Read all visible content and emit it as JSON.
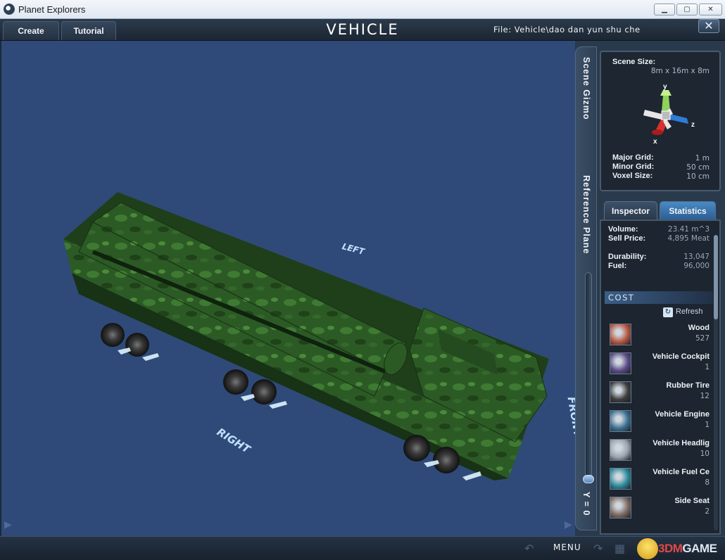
{
  "window": {
    "title": "Planet Explorers",
    "min_glyph": "▁",
    "max_glyph": "▢",
    "close_glyph": "✕"
  },
  "topbar": {
    "tabs": [
      "Create",
      "Tutorial"
    ],
    "title": "VEHICLE",
    "file_label": "File:  Vehicle\\dao dan yun shu che",
    "close_glyph": "✕"
  },
  "viewport": {
    "labels": {
      "left": "LEFT",
      "right": "RIGHT",
      "front": "FRONT"
    },
    "nav_left": "▶",
    "nav_right": "▶"
  },
  "side": {
    "tab_gizmo": "Scene Gizmo",
    "tab_reference": "Reference Plane",
    "y_label": "Y = 0",
    "gizmo": {
      "scene_size_label": "Scene Size:",
      "scene_size_value": "8m x 16m x 8m",
      "axis_y": "y",
      "axis_x": "x",
      "axis_z": "z",
      "major_grid_label": "Major Grid:",
      "major_grid_value": "1 m",
      "minor_grid_label": "Minor Grid:",
      "minor_grid_value": "50 cm",
      "voxel_size_label": "Voxel Size:",
      "voxel_size_value": "10 cm"
    },
    "tabs": {
      "inspector": "Inspector",
      "statistics": "Statistics"
    },
    "stats": {
      "volume_label": "Volume:",
      "volume_value": "23.41 m^3",
      "price_label": "Sell Price:",
      "price_value": "4,895 Meat",
      "durability_label": "Durability:",
      "durability_value": "13,047",
      "fuel_label": "Fuel:",
      "fuel_value": "96,000"
    },
    "cost_header": "COST",
    "refresh_label": "Refresh",
    "refresh_glyph": "↻",
    "cost_items": [
      {
        "name": "Wood",
        "qty": "527",
        "color": "#b5573f"
      },
      {
        "name": "Vehicle Cockpit",
        "qty": "1",
        "color": "#5a4a86"
      },
      {
        "name": "Rubber Tire",
        "qty": "12",
        "color": "#3d3d3d"
      },
      {
        "name": "Vehicle Engine",
        "qty": "1",
        "color": "#3a6f8e"
      },
      {
        "name": "Vehicle Headlig",
        "qty": "10",
        "color": "#9aa4ad"
      },
      {
        "name": "Vehicle Fuel Ce",
        "qty": "8",
        "color": "#2d8a9a"
      },
      {
        "name": "Side Seat",
        "qty": "2",
        "color": "#7d6b63"
      }
    ]
  },
  "bottombar": {
    "menu_label": "MENU",
    "watermark_brand": "3DM",
    "watermark_suffix": "GAME",
    "icons": [
      "undo-icon",
      "redo-icon",
      "grid-icon",
      "camera-icon"
    ]
  },
  "colors": {
    "viewport_bg": "#2f4a78",
    "statistics_tab": "#3a7ab5",
    "vehicle_green": "#2c5a25"
  }
}
